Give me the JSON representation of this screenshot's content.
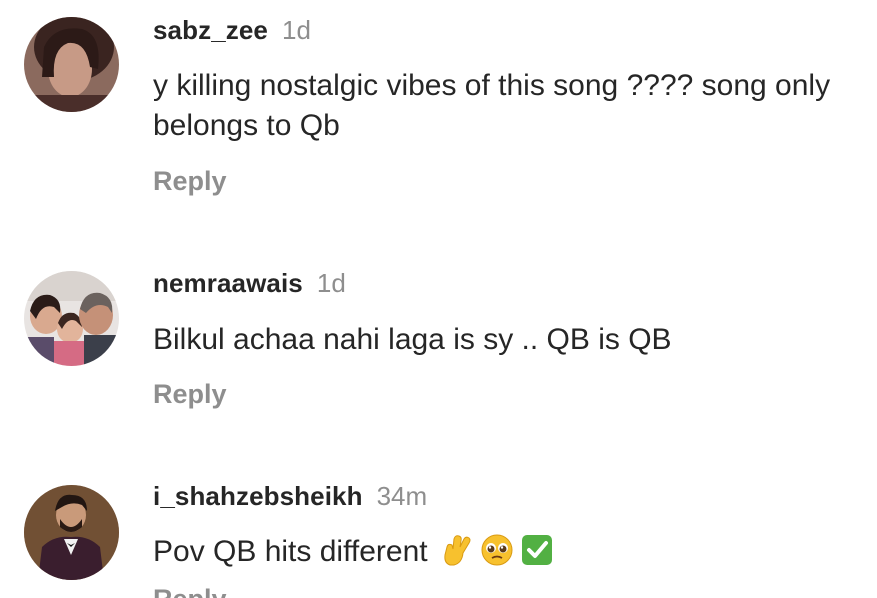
{
  "comments": [
    {
      "username": "sabz_zee",
      "time": "1d",
      "text": "y killing nostalgic vibes of this song ???? song only belongs to Qb",
      "reply": "Reply"
    },
    {
      "username": "nemraawais",
      "time": "1d",
      "text": "Bilkul achaa nahi laga is sy .. QB is QB",
      "reply": "Reply"
    },
    {
      "username": "i_shahzebsheikh",
      "time": "34m",
      "text": "Pov QB hits different",
      "emojis": [
        "crossed-fingers-icon",
        "pleading-face-icon",
        "check-mark-button-icon"
      ],
      "reply": "Reply"
    }
  ],
  "colors": {
    "text": "#262626",
    "secondary": "#8e8e8e",
    "check": "#52b043",
    "emoji_yellow": "#f7c12e"
  }
}
